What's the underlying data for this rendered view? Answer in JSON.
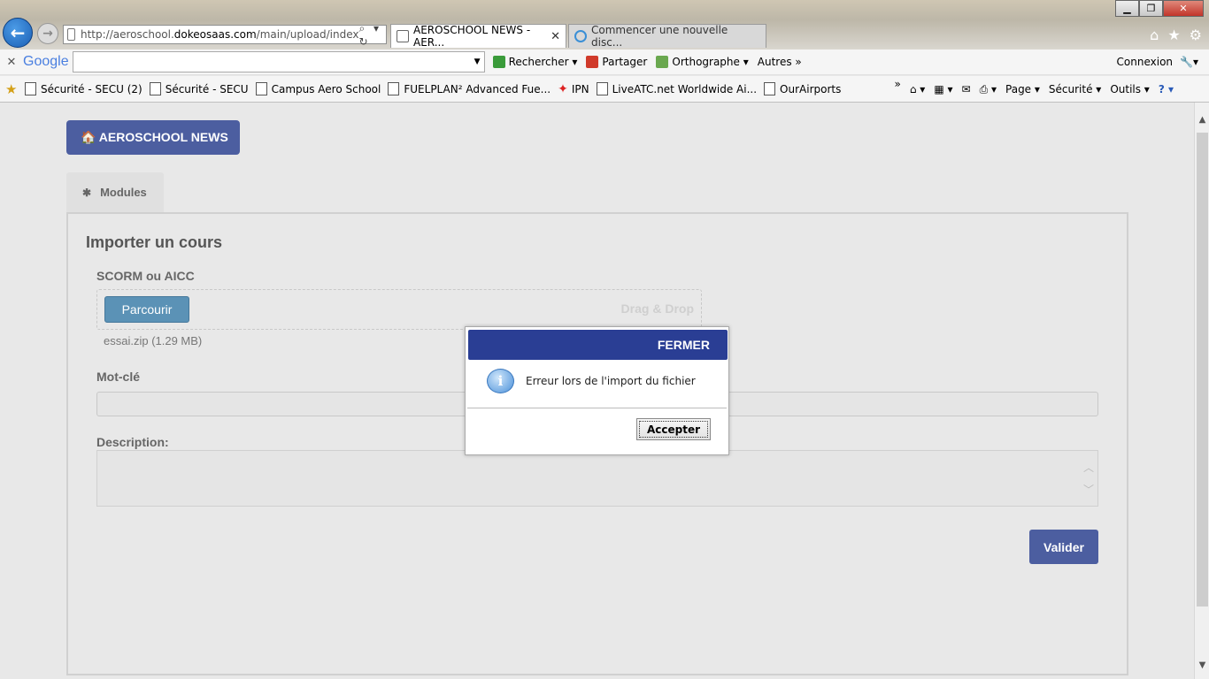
{
  "browser": {
    "address_url_prefix": "http://aeroschool.",
    "address_url_domain": "dokeosaas.com",
    "address_url_path": "/main/upload/index",
    "address_tools": "⌕ ▾ ↻",
    "tabs": [
      {
        "title": "AEROSCHOOL NEWS - AER...",
        "close": "✕"
      },
      {
        "title": "Commencer une nouvelle disc..."
      }
    ],
    "window": {
      "minimize": "▁",
      "maximize": "❐",
      "close": "✕"
    },
    "right_icons": [
      "⌂",
      "★",
      "⚙"
    ]
  },
  "google_toolbar": {
    "close": "✕",
    "logo": "Google",
    "search_value": "",
    "search_dropdown": "▼",
    "items": [
      "Rechercher ▾",
      "Partager",
      "Orthographe ▾",
      "Autres »"
    ],
    "connexion": "Connexion",
    "wrench": "🔧▾"
  },
  "favorites": {
    "star": "★",
    "items": [
      "Sécurité - SECU (2)",
      "Sécurité - SECU",
      "Campus Aero School",
      "FUELPLAN² Advanced Fue...",
      "IPN",
      "LiveATC.net Worldwide Ai...",
      "OurAirports"
    ],
    "overflow": "»",
    "commands": {
      "home": "⌂ ▾",
      "feeds": "▦ ▾",
      "mail": "✉",
      "print": "⎙ ▾",
      "page": "Page ▾",
      "security": "Sécurité ▾",
      "tools": "Outils ▾",
      "help": "? ▾"
    }
  },
  "page": {
    "home_button": "🏠 AEROSCHOOL NEWS",
    "modules_tab": "Modules",
    "modules_icon": "✱",
    "panel_title": "Importer un cours",
    "scorm_label": "SCORM ou AICC",
    "browse_button": "Parcourir",
    "drag_drop": "Drag & Drop",
    "file_info": "essai.zip (1.29 MB)",
    "keyword_label": "Mot-clé",
    "keyword_value": "",
    "description_label": "Description:",
    "description_value": "",
    "validate_button": "Valider"
  },
  "dialog": {
    "header": "FERMER",
    "icon": "i",
    "message": "Erreur lors de l'import du fichier",
    "accept_button": "Accepter"
  },
  "scrollbar": {
    "up": "▲",
    "down": "▼"
  }
}
